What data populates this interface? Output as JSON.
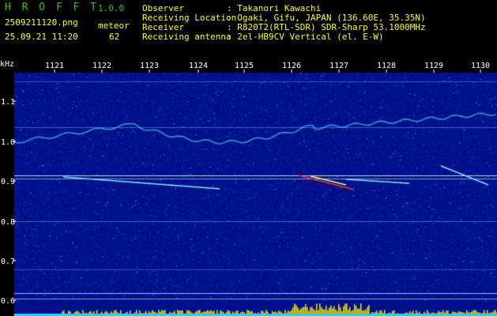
{
  "header": {
    "app_title": "H R O F F T",
    "version": "1.0.0",
    "file_name": "2509211120.png",
    "mode": "meteor",
    "timestamp": "25.09.21 11:20",
    "meteor_count": "62",
    "observer_label": "Observer",
    "observer_value": ": Takanori Kawachi",
    "location_label": "Receiving Location",
    "location_value": ": Ogaki, Gifu, JAPAN (136.60E, 35.35N)",
    "receiver_label": "Receiver",
    "receiver_value": ": R820T2(RTL-SDR) SDR-Sharp 53.1000MHz",
    "antenna_label": "Receiving antenna",
    "antenna_value": ": 2el-HB9CV Vertical (el. E-W)"
  },
  "axis": {
    "unit": "kHz",
    "x_ticks": [
      "1121",
      "1122",
      "1123",
      "1124",
      "1125",
      "1126",
      "1127",
      "1128",
      "1129",
      "1130"
    ],
    "y_ticks": [
      "1.1",
      "1.0",
      "0.9",
      "0.8",
      "0.7",
      "0.6"
    ]
  },
  "colors": {
    "background": "#000000",
    "spectrum_base": "#00108a",
    "header_green": "#22c622",
    "header_yellow": "#ffff00",
    "header_white": "#ffffff",
    "signal_cyan": "#40e0ff",
    "signal_hot": "#ff3030",
    "activity_bars": "#ffe000"
  }
}
